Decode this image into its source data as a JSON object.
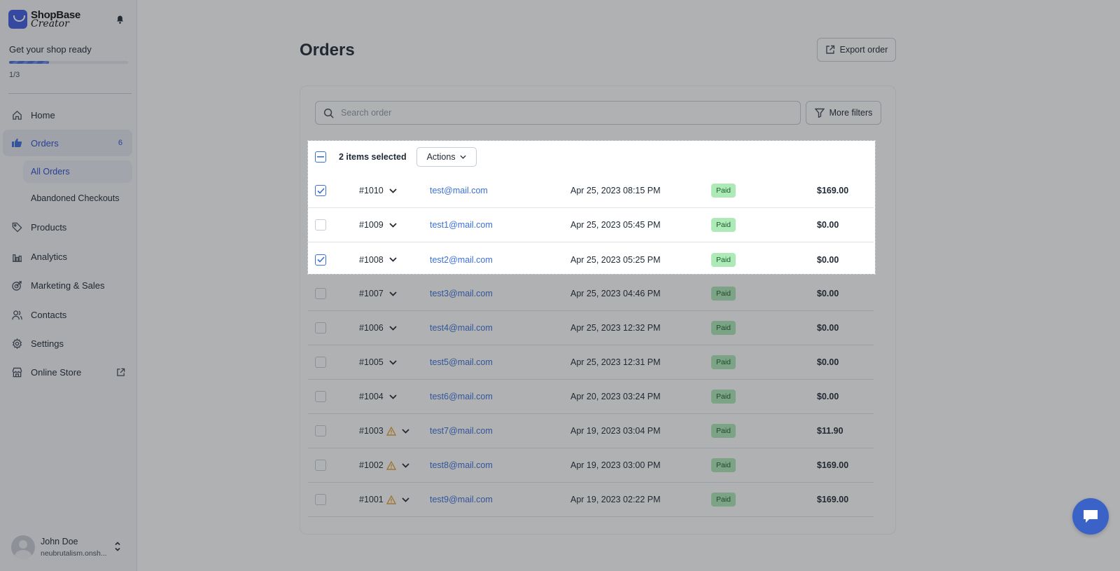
{
  "app": {
    "logo_line1": "ShopBase",
    "logo_line2": "Creator"
  },
  "setup": {
    "title": "Get your shop ready",
    "progress_text": "1/3",
    "progress_fraction": 0.333
  },
  "sidebar": {
    "items": [
      {
        "label": "Home",
        "icon": "home-icon"
      },
      {
        "label": "Orders",
        "icon": "orders-icon",
        "badge": "6",
        "active": true
      },
      {
        "label": "Products",
        "icon": "tag-icon"
      },
      {
        "label": "Analytics",
        "icon": "chart-icon"
      },
      {
        "label": "Marketing & Sales",
        "icon": "target-icon"
      },
      {
        "label": "Contacts",
        "icon": "people-icon"
      },
      {
        "label": "Settings",
        "icon": "gear-icon"
      },
      {
        "label": "Online Store",
        "icon": "store-icon"
      }
    ],
    "sub_items": [
      {
        "label": "All Orders",
        "active": true
      },
      {
        "label": "Abandoned Checkouts"
      }
    ]
  },
  "user": {
    "name": "John Doe",
    "shop": "neubrutalism.onsh..."
  },
  "page": {
    "title": "Orders",
    "export_label": "Export order"
  },
  "search": {
    "placeholder": "Search order",
    "filters_label": "More filters"
  },
  "bulk": {
    "selected_label": "2 items selected",
    "actions_label": "Actions"
  },
  "orders": [
    {
      "id": "#1010",
      "email": "test@mail.com",
      "date": "Apr 25, 2023 08:15 PM",
      "status": "Paid",
      "total": "$169.00",
      "checked": true,
      "warning": false
    },
    {
      "id": "#1009",
      "email": "test1@mail.com",
      "date": "Apr 25, 2023 05:45 PM",
      "status": "Paid",
      "total": "$0.00",
      "checked": false,
      "warning": false
    },
    {
      "id": "#1008",
      "email": "test2@mail.com",
      "date": "Apr 25, 2023 05:25 PM",
      "status": "Paid",
      "total": "$0.00",
      "checked": true,
      "warning": false
    },
    {
      "id": "#1007",
      "email": "test3@mail.com",
      "date": "Apr 25, 2023 04:46 PM",
      "status": "Paid",
      "total": "$0.00",
      "checked": false,
      "warning": false
    },
    {
      "id": "#1006",
      "email": "test4@mail.com",
      "date": "Apr 25, 2023 12:32 PM",
      "status": "Paid",
      "total": "$0.00",
      "checked": false,
      "warning": false
    },
    {
      "id": "#1005",
      "email": "test5@mail.com",
      "date": "Apr 25, 2023 12:31 PM",
      "status": "Paid",
      "total": "$0.00",
      "checked": false,
      "warning": false
    },
    {
      "id": "#1004",
      "email": "test6@mail.com",
      "date": "Apr 20, 2023 03:24 PM",
      "status": "Paid",
      "total": "$0.00",
      "checked": false,
      "warning": false
    },
    {
      "id": "#1003",
      "email": "test7@mail.com",
      "date": "Apr 19, 2023 03:04 PM",
      "status": "Paid",
      "total": "$11.90",
      "checked": false,
      "warning": true
    },
    {
      "id": "#1002",
      "email": "test8@mail.com",
      "date": "Apr 19, 2023 03:00 PM",
      "status": "Paid",
      "total": "$169.00",
      "checked": false,
      "warning": true
    },
    {
      "id": "#1001",
      "email": "test9@mail.com",
      "date": "Apr 19, 2023 02:22 PM",
      "status": "Paid",
      "total": "$169.00",
      "checked": false,
      "warning": true
    }
  ],
  "colors": {
    "accent": "#3b6fd9",
    "paid_badge_bg": "#aee9b8",
    "warning": "#e8a33d",
    "overlay": "#23282d"
  }
}
